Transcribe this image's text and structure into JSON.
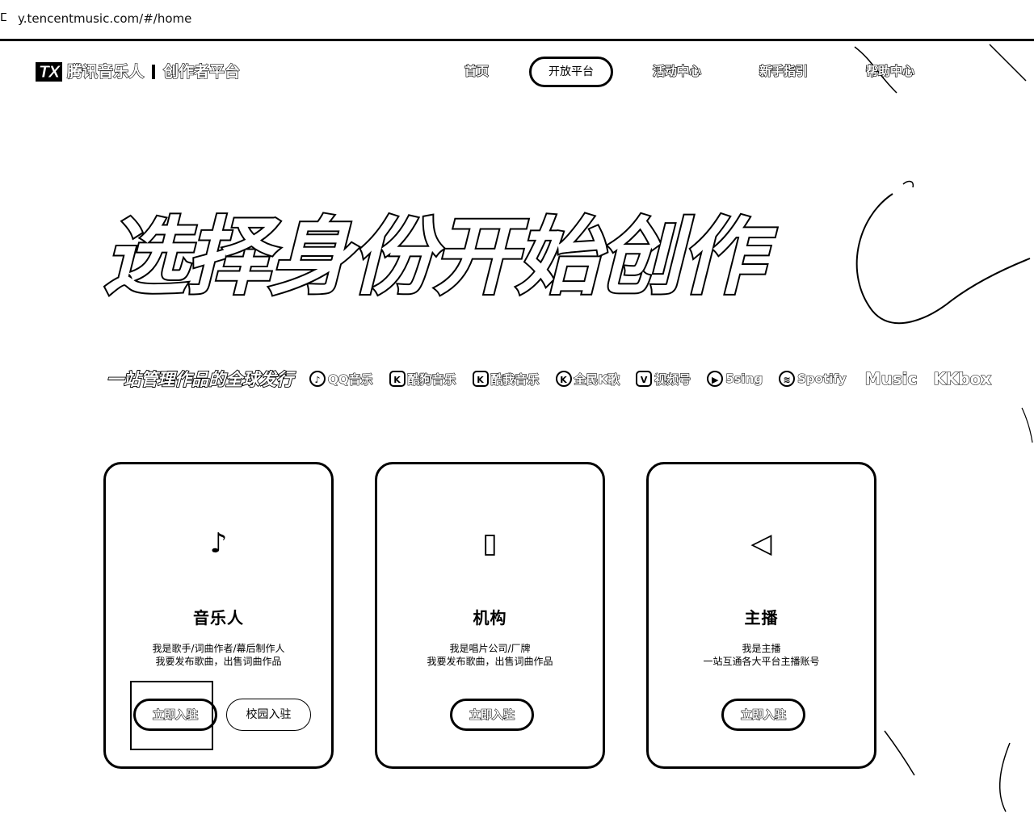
{
  "browser": {
    "url": "y.tencentmusic.com/#/home",
    "site_icon": "ⵎ"
  },
  "logo": {
    "mark": "TX",
    "name": "腾讯音乐人",
    "subtitle": "创作者平台"
  },
  "nav": {
    "items": [
      {
        "label": "首页"
      },
      {
        "label": "开放平台",
        "active": true
      },
      {
        "label": "活动中心"
      },
      {
        "label": "新手指引"
      },
      {
        "label": "帮助中心"
      }
    ]
  },
  "hero": {
    "title": "选择身份开始创作",
    "tagline": "一站管理作品的全球发行",
    "platforms": [
      {
        "icon": "music-note-icon",
        "glyph": "♪",
        "label": "QQ音乐"
      },
      {
        "icon": "kugou-icon",
        "glyph": "K",
        "label": "酷狗音乐"
      },
      {
        "icon": "kuwo-icon",
        "glyph": "K",
        "label": "酷我音乐"
      },
      {
        "icon": "quanmin-icon",
        "glyph": "K",
        "label": "全民K歌"
      },
      {
        "icon": "shipinhao-icon",
        "glyph": "V",
        "label": "视频号"
      },
      {
        "icon": "5sing-icon",
        "glyph": "▶",
        "label": "5sing"
      },
      {
        "icon": "spotify-icon",
        "glyph": "≋",
        "label": "Spotify"
      },
      {
        "icon": "apple-icon",
        "glyph": "",
        "label": "Music"
      },
      {
        "icon": "",
        "glyph": "",
        "label": "KKbox"
      }
    ]
  },
  "cards": [
    {
      "icon": "music-note-icon",
      "glyph": "♪",
      "title": "音乐人",
      "desc_line1": "我是歌手/词曲作者/幕后制作人",
      "desc_line2": "我要发布歌曲，出售词曲作品",
      "primary_button": "立即入驻",
      "secondary_button": "校园入驻"
    },
    {
      "icon": "building-icon",
      "glyph": "▯",
      "title": "机构",
      "desc_line1": "我是唱片公司/厂牌",
      "desc_line2": "我要发布歌曲，出售词曲作品",
      "primary_button": "立即入驻"
    },
    {
      "icon": "megaphone-icon",
      "glyph": "◁",
      "title": "主播",
      "desc_line1": "我是主播",
      "desc_line2": "一站互通各大平台主播账号",
      "primary_button": "立即入驻"
    }
  ]
}
